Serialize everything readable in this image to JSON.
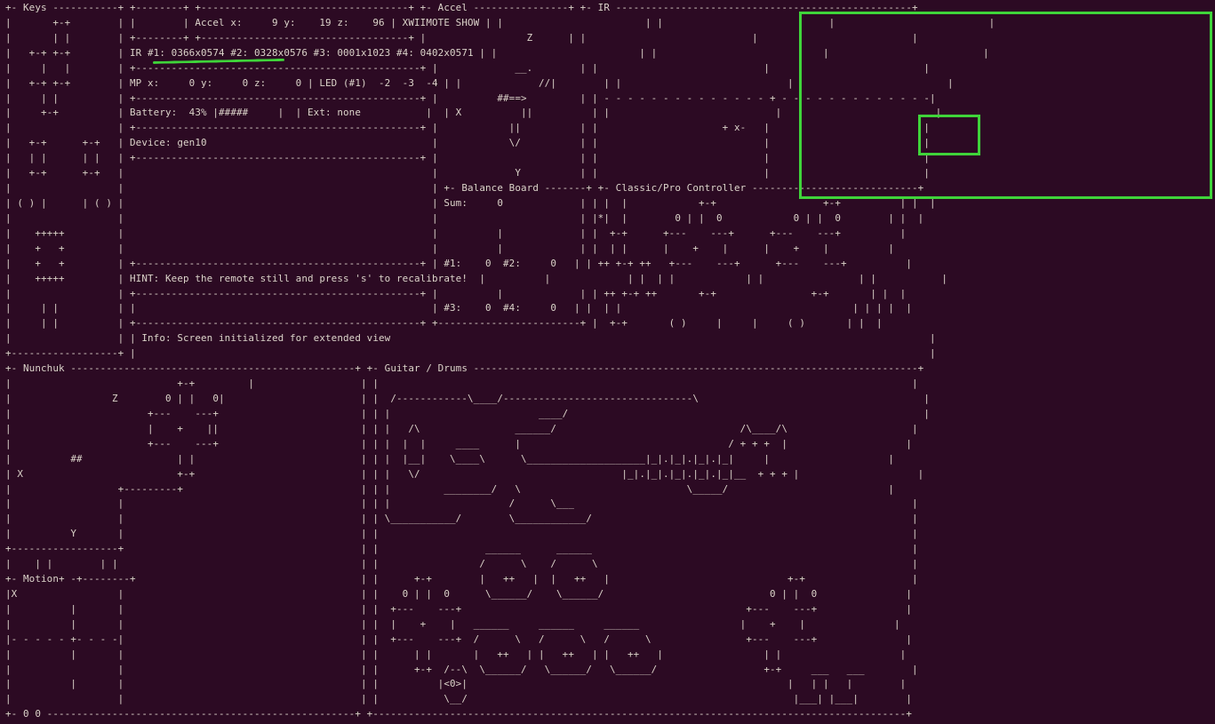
{
  "terminal": {
    "title": "XWIIMOTE SHOW",
    "lines": [
      "+- Keys -----------+ +--------+ +-----------------------------------+ +- Accel ----------------+ +- IR --------------------------------------------------+",
      "|       +-+        | |        | Accel x:     9 y:    19 z:    96 | XWIIMOTE SHOW | |                        | |                            |                          |",
      "|       | |        | +--------+ +-----------------------------------+ |                 Z      | |                            |                          |",
      "|   +-+ +-+        | IR #1: 0366x0574 #2: 0328x0576 #3: 0001x1023 #4: 0402x0571 | |                        | |                            |                          |",
      "|     |   |        | +------------------------------------------------+ |             __.        | |                            |                          |",
      "|   +-+ +-+        | MP x:     0 y:     0 z:     0 | LED (#1)  -2  -3  -4 | |             //|        | |                            |                          |",
      "|     | |          | +------------------------------------------------+ |          ##==>         | | - - - - - - - - - - - - - - + - - - - - - - - - - - - -|",
      "|     +-+          | Battery:  43% |#####     |  | Ext: none           |  | X          ||          | |                            |                          |",
      "|                  | +------------------------------------------------+ |            ||          | |                     + x-   |                          |",
      "|   +-+      +-+   | Device: gen10                                      |            \\/          | |                            |                          |",
      "|   | |      | |   | +------------------------------------------------+ |                        | |                            |                          |",
      "|   +-+      +-+   |                                                    |             Y          | |                            |                          |",
      "|                  |                                                    | +- Balance Board -------+ +- Classic/Pro Controller ----------------------------+",
      "| ( ) |      | ( ) |                                                    | Sum:     0             | | |  |            +-+                  +-+          | |  |",
      "|                  |                                                    |                        | |*|  |        0 | |  0            0 | |  0        | |  |",
      "|    +++++         |                                                    |          |             | |  +-+      +---    ---+      +---    ---+          |",
      "|    +   +         |                                                    |          |             | |  | |      |    +    |      |    +    |          |",
      "|    +   +         | +------------------------------------------------+ | #1:    0  #2:     0   | | ++ +-+ ++   +---    ---+      +---    ---+          |",
      "|    +++++         | HINT: Keep the remote still and press 's' to recalibrate!  |          |             | |  | |            | |                | |           |",
      "|                  | +------------------------------------------------+ |          |             | | ++ +-+ ++       +-+                +-+       | |  |",
      "|     | |          | |                                                  | #3:    0  #4:     0   | |  | |                                       | | | |  |",
      "|     | |          | +------------------------------------------------+ +------------------------+ |  +-+       ( )     |     |     ( )       | |  |",
      "|                  | | Info: Screen initialized for extended view                                                                                           |",
      "+------------------+ |                                                                                                                                      |",
      "+- Nunchuk ------------------------------------------------+ +- Guitar / Drums ---------------------------------------------------------------------------+",
      "|                            +-+         |                  | |                                                                                          |",
      "|                 Z        0 | |   0|                       | |  /------------\\____/--------------------------------\\                                      |",
      "|                       +---    ---+                        | | |                         ____/                                                            |",
      "|                       |    +    ||                        | | |   /\\                ______/                               /\\____/\\                     |",
      "|                       +---    ---+                        | | |  |  |     ____      |                                   / + + +  |                    |",
      "|          ##                | |                            | | |  |__|    \\____\\      \\____________________|_|.|_|.|_|.|_|     |                    |",
      "| X                          +-+                            | | |   \\/                                  |_|.|_|.|_|.|_|.|_|__  + + + |                    |",
      "|                  +---------+                              | | |         ________/   \\                            \\_____/                           |",
      "|                  |                                        | | |                    /      \\___                                                         |",
      "|                  |                                        | | \\___________/        \\____________/                                                      |",
      "|          Y       |                                        | |                                                                                          |",
      "+------------------+                                        | |                  ______      ______                                                      |",
      "|    | |        | |                                         | |                 /      \\    /      \\                                                     |",
      "+- Motion+ -+--------+                                      | |      +-+        |   ++   |  |   ++   |                              +-+                  |",
      "|X                 |                                        | |    0 | |  0      \\______/    \\______/                            0 | |  0               |",
      "|          |       |                                        | |  +---    ---+                                                +---    ---+               |",
      "|          |       |                                        | |  |    +    |   ______     ______     ______                 |    +    |               |",
      "|- - - - - +- - - -|                                        | |  +---    ---+  /      \\   /      \\   /      \\                +---    ---+               |",
      "|          |       |                                        | |      | |       |   ++   | |   ++   | |   ++   |                 | |                    |",
      "|                  |                                        | |      +-+  /--\\  \\______/   \\______/   \\______/                  +-+     ___   ___        |",
      "|          |       |                                        | |          |<0>|                                                      |   | |   |        |",
      "|                  |                                        | |           \\__/                                                       |___| |___|        |",
      "+- 0 0 ----------------------------------------------------+ +------------------------------------------------------------------------------------------+"
    ]
  }
}
